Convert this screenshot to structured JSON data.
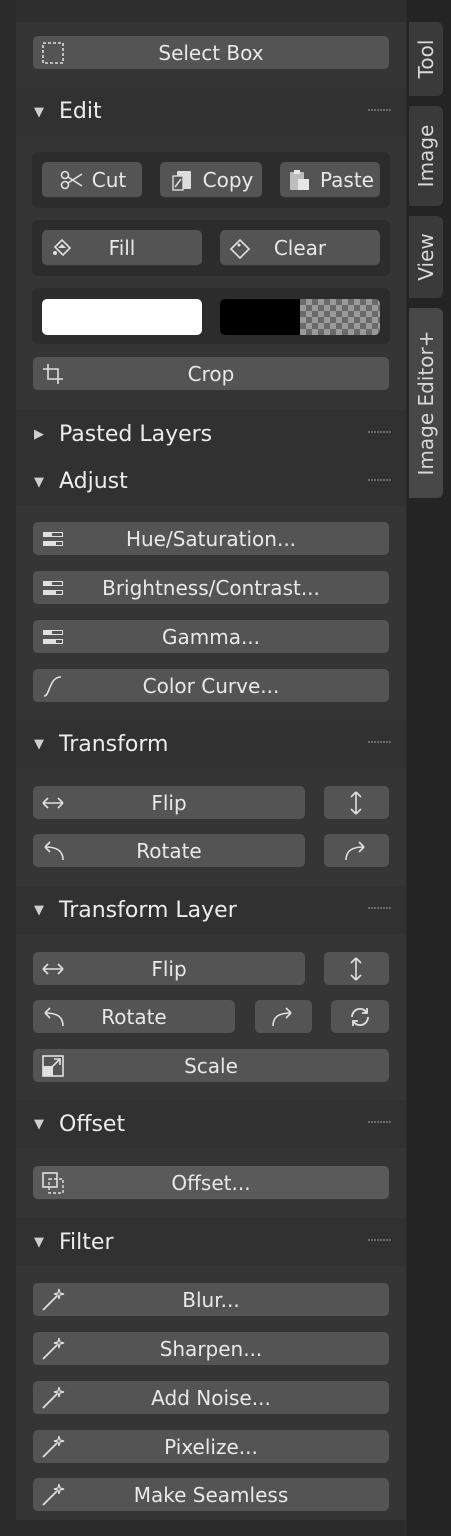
{
  "tool": {
    "select_box": "Select Box"
  },
  "edit": {
    "title": "Edit",
    "cut": "Cut",
    "copy": "Copy",
    "paste": "Paste",
    "fill": "Fill",
    "clear": "Clear",
    "foreground_color": "#ffffff",
    "background_color": "#000000",
    "crop": "Crop"
  },
  "pasted_layers": {
    "title": "Pasted Layers"
  },
  "adjust": {
    "title": "Adjust",
    "hue": "Hue/Saturation...",
    "brightness": "Brightness/Contrast...",
    "gamma": "Gamma...",
    "curve": "Color Curve..."
  },
  "transform": {
    "title": "Transform",
    "flip": "Flip",
    "rotate": "Rotate"
  },
  "transform_layer": {
    "title": "Transform Layer",
    "flip": "Flip",
    "rotate": "Rotate",
    "scale": "Scale"
  },
  "offset": {
    "title": "Offset",
    "offset": "Offset..."
  },
  "filter": {
    "title": "Filter",
    "blur": "Blur...",
    "sharpen": "Sharpen...",
    "noise": "Add Noise...",
    "pixelize": "Pixelize...",
    "seamless": "Make Seamless"
  },
  "tabs": [
    "Tool",
    "Image",
    "View",
    "Image Editor+"
  ]
}
